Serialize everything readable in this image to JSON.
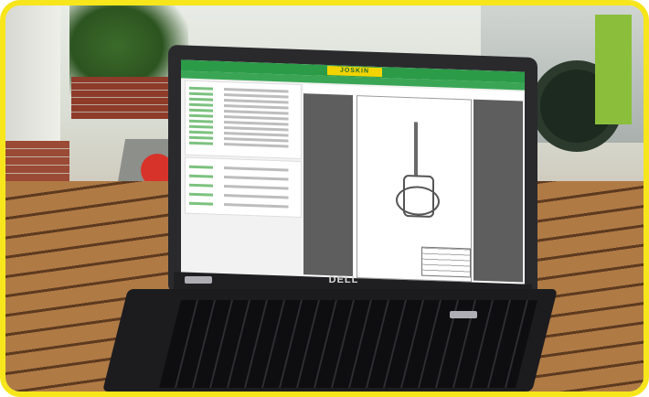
{
  "laptop": {
    "brand": "DELL"
  },
  "app": {
    "logo_text": "JOSKIN",
    "subtitle": "",
    "accent_color": "#2b9b48",
    "logo_color": "#f2d400"
  },
  "scene": {
    "frame_color": "#f6e61b",
    "sign_icon": "red-circle-sign"
  }
}
